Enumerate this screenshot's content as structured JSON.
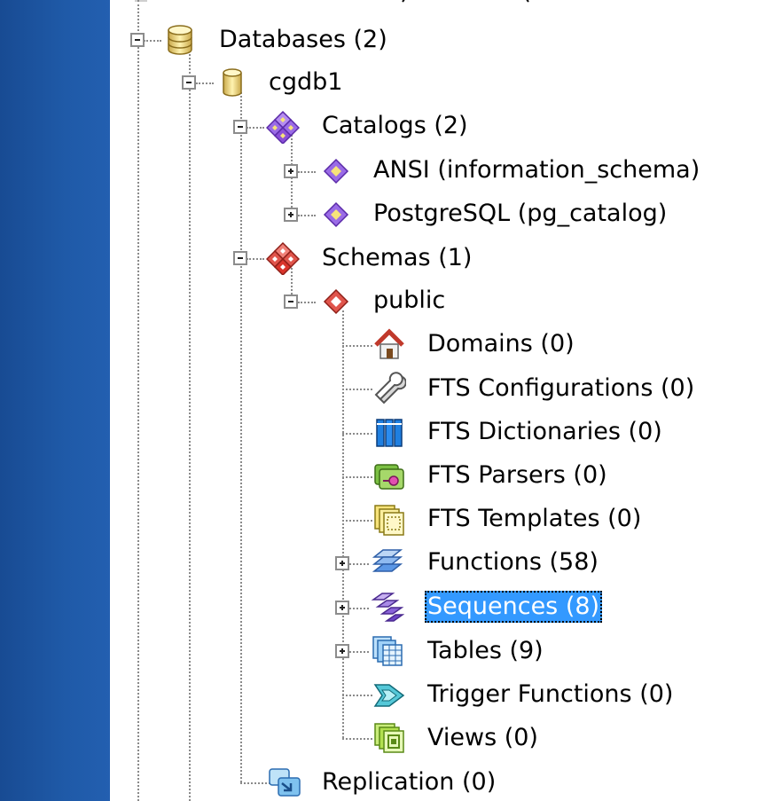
{
  "tree": {
    "databases_label": "Databases (2)",
    "db_label": "cgdb1",
    "catalogs_label": "Catalogs (2)",
    "catalog_items": [
      "ANSI (information_schema)",
      "PostgreSQL (pg_catalog)"
    ],
    "schemas_label": "Schemas (1)",
    "schema_label": "public",
    "schema_children": [
      "Domains (0)",
      "FTS Configurations (0)",
      "FTS Dictionaries (0)",
      "FTS Parsers (0)",
      "FTS Templates (0)",
      "Functions (58)",
      "Sequences (8)",
      "Tables (9)",
      "Trigger Functions (0)",
      "Views (0)"
    ],
    "replication_label": "Replication (0)",
    "selected_item": "Sequences (8)"
  },
  "colors": {
    "desktop_blue": "#1d4f9a",
    "selection_blue": "#3399ff",
    "catalog_purple": "#8a4fd8",
    "schema_red": "#d9342b"
  },
  "icons": {
    "databases": "database-stack-icon",
    "db": "database-cylinder-icon",
    "catalogs": "catalogs-icon",
    "catalog_item": "catalog-diamond-icon",
    "schemas": "schemas-icon",
    "schema": "schema-diamond-icon",
    "domains": "house-icon",
    "fts_configurations": "wrench-icon",
    "fts_dictionaries": "books-icon",
    "fts_parsers": "parser-icon",
    "fts_templates": "template-icon",
    "functions": "functions-icon",
    "sequences": "sequence-icon",
    "tables": "table-icon",
    "trigger_functions": "trigger-icon",
    "views": "view-icon",
    "replication": "replication-icon"
  }
}
